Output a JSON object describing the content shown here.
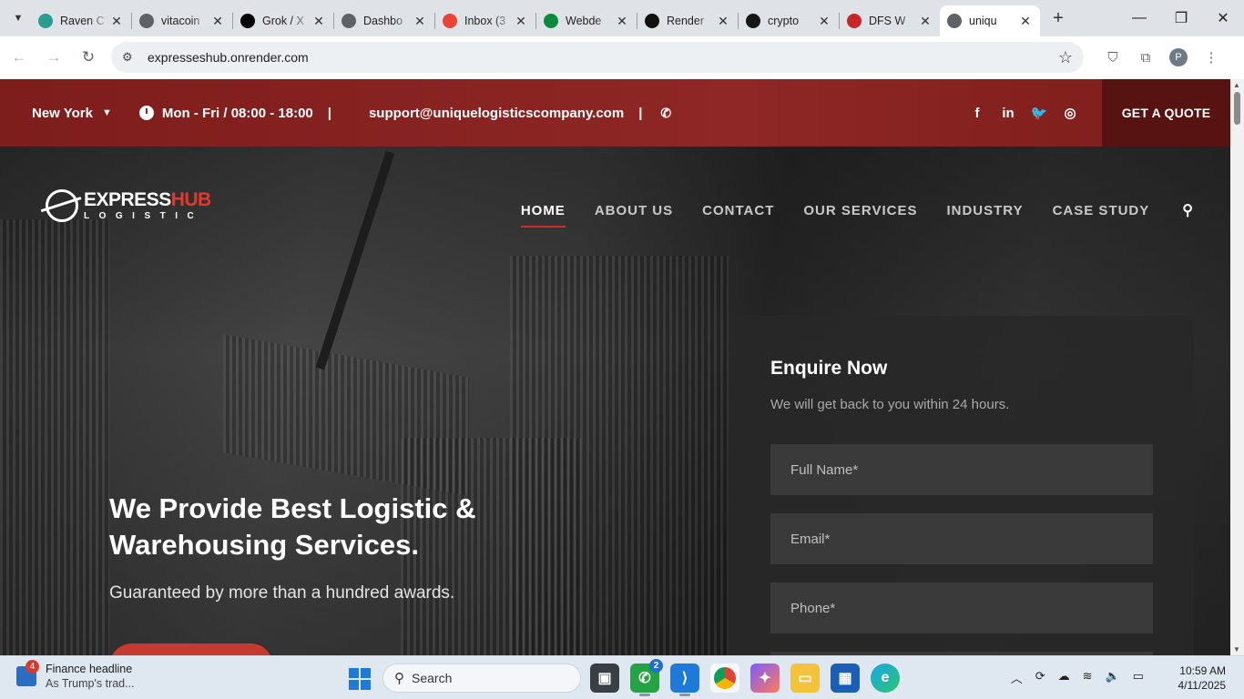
{
  "browser": {
    "tabs": [
      {
        "title": "Raven C",
        "icon": "raven-icon",
        "color": "#2a9d8f"
      },
      {
        "title": "vitacoin",
        "icon": "globe-icon",
        "color": "#5f6368"
      },
      {
        "title": "Grok / X",
        "icon": "x-icon",
        "color": "#000000"
      },
      {
        "title": "Dashbo",
        "icon": "globe-icon",
        "color": "#5f6368"
      },
      {
        "title": "Inbox (3",
        "icon": "gmail-icon",
        "color": "#ea4335"
      },
      {
        "title": "Webde",
        "icon": "webdev-icon",
        "color": "#0b8a3e"
      },
      {
        "title": "Render",
        "icon": "render-icon",
        "color": "#111111"
      },
      {
        "title": "crypto",
        "icon": "github-icon",
        "color": "#161616"
      },
      {
        "title": "DFS W",
        "icon": "dfs-icon",
        "color": "#c62828"
      },
      {
        "title": "uniqu",
        "icon": "globe-icon",
        "color": "#5f6368",
        "active": true
      }
    ],
    "new_tab": "+",
    "address": "expresseshub.onrender.com",
    "profile_initial": "P"
  },
  "site": {
    "topbar": {
      "city": "New York",
      "hours": "Mon - Fri / 08:00 - 18:00",
      "separator": "|",
      "email": "support@uniquelogisticscompany.com",
      "quote_button": "GET A QUOTE"
    },
    "logo": {
      "brand_a": "EXPRESS",
      "brand_b": "HUB",
      "sub": "LOGISTIC"
    },
    "nav": [
      "HOME",
      "ABOUT US",
      "CONTACT",
      "OUR SERVICES",
      "INDUSTRY",
      "CASE STUDY"
    ],
    "hero": {
      "headline": "We Provide Best Logistic & Warehousing Services.",
      "tagline": "Guaranteed by more than a hundred awards."
    },
    "enquiry": {
      "title": "Enquire Now",
      "subtitle": "We will get back to you within 24 hours.",
      "name_placeholder": "Full Name*",
      "email_placeholder": "Email*",
      "phone_placeholder": "Phone*"
    },
    "colors": {
      "topbar": "#8b2422",
      "quote": "#561311",
      "accent": "#c9302c"
    }
  },
  "taskbar": {
    "news_badge": "4",
    "news_title": "Finance headline",
    "news_sub": "As Trump's trad...",
    "search_label": "Search",
    "whatsapp_badge": "2",
    "time": "10:59 AM",
    "date": "4/11/2025"
  }
}
